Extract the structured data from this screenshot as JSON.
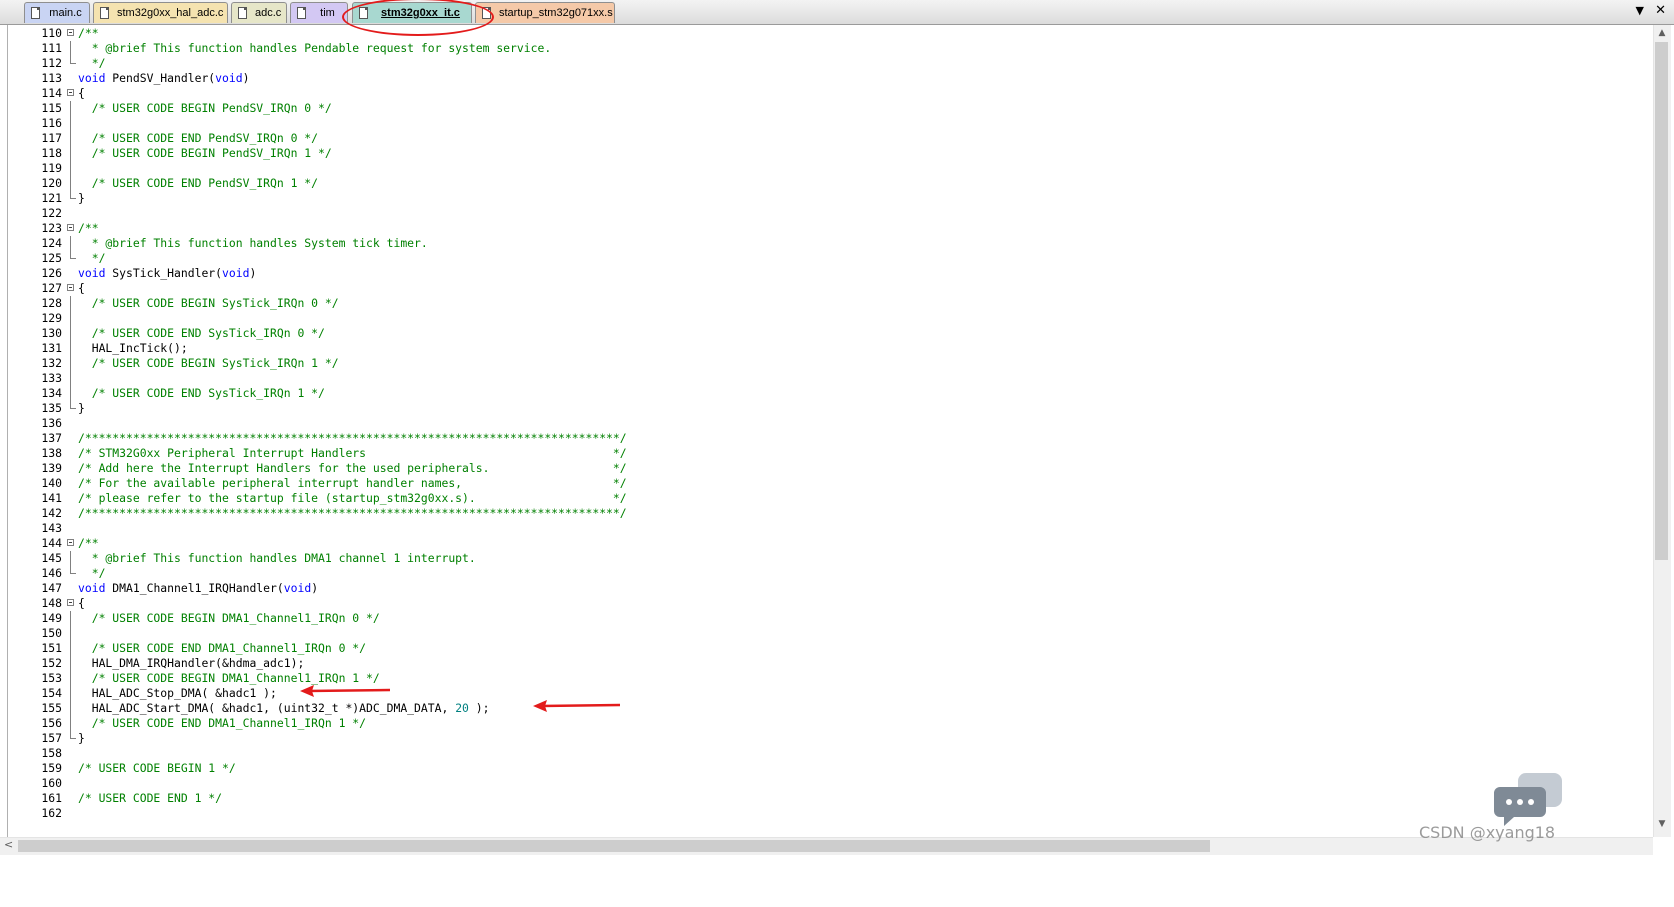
{
  "tabs": [
    {
      "label": "main.c",
      "color": "#c9d4f3"
    },
    {
      "label": "stm32g0xx_hal_adc.c",
      "color": "#f5e3b0"
    },
    {
      "label": "adc.c",
      "color": "#e6e6c8"
    },
    {
      "label": "tim",
      "color": "#d3c8f3"
    },
    {
      "label": "stm32g0xx_it.c",
      "color": "#a8d8d0"
    },
    {
      "label": "startup_stm32g071xx.s",
      "color": "#f5c9a8"
    }
  ],
  "tab_controls": {
    "dropdown": "▼",
    "close": "✕"
  },
  "code_lines": [
    {
      "n": "110",
      "t": [
        [
          "c",
          "/**"
        ]
      ]
    },
    {
      "n": "111",
      "t": [
        [
          "c",
          "  * @brief This function handles Pendable request for system service."
        ]
      ]
    },
    {
      "n": "112",
      "t": [
        [
          "c",
          "  */"
        ]
      ]
    },
    {
      "n": "113",
      "t": [
        [
          "k",
          "void"
        ],
        [
          "p",
          " PendSV_Handler("
        ],
        [
          "k",
          "void"
        ],
        [
          "p",
          ")"
        ]
      ]
    },
    {
      "n": "114",
      "t": [
        [
          "p",
          "{"
        ]
      ]
    },
    {
      "n": "115",
      "t": [
        [
          "c",
          "  /* USER CODE BEGIN PendSV_IRQn 0 */"
        ]
      ]
    },
    {
      "n": "116",
      "t": []
    },
    {
      "n": "117",
      "t": [
        [
          "c",
          "  /* USER CODE END PendSV_IRQn 0 */"
        ]
      ]
    },
    {
      "n": "118",
      "t": [
        [
          "c",
          "  /* USER CODE BEGIN PendSV_IRQn 1 */"
        ]
      ]
    },
    {
      "n": "119",
      "t": []
    },
    {
      "n": "120",
      "t": [
        [
          "c",
          "  /* USER CODE END PendSV_IRQn 1 */"
        ]
      ]
    },
    {
      "n": "121",
      "t": [
        [
          "p",
          "}"
        ]
      ]
    },
    {
      "n": "122",
      "t": []
    },
    {
      "n": "123",
      "t": [
        [
          "c",
          "/**"
        ]
      ]
    },
    {
      "n": "124",
      "t": [
        [
          "c",
          "  * @brief This function handles System tick timer."
        ]
      ]
    },
    {
      "n": "125",
      "t": [
        [
          "c",
          "  */"
        ]
      ]
    },
    {
      "n": "126",
      "t": [
        [
          "k",
          "void"
        ],
        [
          "p",
          " SysTick_Handler("
        ],
        [
          "k",
          "void"
        ],
        [
          "p",
          ")"
        ]
      ]
    },
    {
      "n": "127",
      "t": [
        [
          "p",
          "{"
        ]
      ]
    },
    {
      "n": "128",
      "t": [
        [
          "c",
          "  /* USER CODE BEGIN SysTick_IRQn 0 */"
        ]
      ]
    },
    {
      "n": "129",
      "t": []
    },
    {
      "n": "130",
      "t": [
        [
          "c",
          "  /* USER CODE END SysTick_IRQn 0 */"
        ]
      ]
    },
    {
      "n": "131",
      "t": [
        [
          "p",
          "  HAL_IncTick();"
        ]
      ]
    },
    {
      "n": "132",
      "t": [
        [
          "c",
          "  /* USER CODE BEGIN SysTick_IRQn 1 */"
        ]
      ]
    },
    {
      "n": "133",
      "t": []
    },
    {
      "n": "134",
      "t": [
        [
          "c",
          "  /* USER CODE END SysTick_IRQn 1 */"
        ]
      ]
    },
    {
      "n": "135",
      "t": [
        [
          "p",
          "}"
        ]
      ]
    },
    {
      "n": "136",
      "t": []
    },
    {
      "n": "137",
      "t": [
        [
          "c",
          "/******************************************************************************/"
        ]
      ]
    },
    {
      "n": "138",
      "t": [
        [
          "c",
          "/* STM32G0xx Peripheral Interrupt Handlers                                    */"
        ]
      ]
    },
    {
      "n": "139",
      "t": [
        [
          "c",
          "/* Add here the Interrupt Handlers for the used peripherals.                  */"
        ]
      ]
    },
    {
      "n": "140",
      "t": [
        [
          "c",
          "/* For the available peripheral interrupt handler names,                      */"
        ]
      ]
    },
    {
      "n": "141",
      "t": [
        [
          "c",
          "/* please refer to the startup file (startup_stm32g0xx.s).                    */"
        ]
      ]
    },
    {
      "n": "142",
      "t": [
        [
          "c",
          "/******************************************************************************/"
        ]
      ]
    },
    {
      "n": "143",
      "t": []
    },
    {
      "n": "144",
      "t": [
        [
          "c",
          "/**"
        ]
      ]
    },
    {
      "n": "145",
      "t": [
        [
          "c",
          "  * @brief This function handles DMA1 channel 1 interrupt."
        ]
      ]
    },
    {
      "n": "146",
      "t": [
        [
          "c",
          "  */"
        ]
      ]
    },
    {
      "n": "147",
      "t": [
        [
          "k",
          "void"
        ],
        [
          "p",
          " DMA1_Channel1_IRQHandler("
        ],
        [
          "k",
          "void"
        ],
        [
          "p",
          ")"
        ]
      ]
    },
    {
      "n": "148",
      "t": [
        [
          "p",
          "{"
        ]
      ]
    },
    {
      "n": "149",
      "t": [
        [
          "c",
          "  /* USER CODE BEGIN DMA1_Channel1_IRQn 0 */"
        ]
      ]
    },
    {
      "n": "150",
      "t": []
    },
    {
      "n": "151",
      "t": [
        [
          "c",
          "  /* USER CODE END DMA1_Channel1_IRQn 0 */"
        ]
      ]
    },
    {
      "n": "152",
      "t": [
        [
          "p",
          "  HAL_DMA_IRQHandler(&hdma_adc1);"
        ]
      ]
    },
    {
      "n": "153",
      "t": [
        [
          "c",
          "  /* USER CODE BEGIN DMA1_Channel1_IRQn 1 */"
        ]
      ]
    },
    {
      "n": "154",
      "t": [
        [
          "p",
          "  HAL_ADC_Stop_DMA( &hadc1 );"
        ]
      ]
    },
    {
      "n": "155",
      "t": [
        [
          "p",
          "  HAL_ADC_Start_DMA( &hadc1, (uint32_t *)ADC_DMA_DATA, "
        ],
        [
          "n",
          "20"
        ],
        [
          "p",
          " );"
        ]
      ]
    },
    {
      "n": "156",
      "t": [
        [
          "c",
          "  /* USER CODE END DMA1_Channel1_IRQn 1 */"
        ]
      ]
    },
    {
      "n": "157",
      "t": [
        [
          "p",
          "}"
        ]
      ]
    },
    {
      "n": "158",
      "t": []
    },
    {
      "n": "159",
      "t": [
        [
          "c",
          "/* USER CODE BEGIN 1 */"
        ]
      ]
    },
    {
      "n": "160",
      "t": []
    },
    {
      "n": "161",
      "t": [
        [
          "c",
          "/* USER CODE END 1 */"
        ]
      ]
    },
    {
      "n": "162",
      "t": []
    }
  ],
  "folds": {
    "open": [
      "110",
      "114",
      "123",
      "127",
      "144",
      "148"
    ],
    "end": [
      "112",
      "121",
      "125",
      "135",
      "146",
      "157"
    ],
    "body": [
      "111",
      "115",
      "116",
      "117",
      "118",
      "119",
      "120",
      "124",
      "128",
      "129",
      "130",
      "131",
      "132",
      "133",
      "134",
      "145",
      "149",
      "150",
      "151",
      "152",
      "153",
      "154",
      "155",
      "156"
    ]
  },
  "annotation_color": "#e31b1b",
  "watermark": "CSDN @xyang18"
}
